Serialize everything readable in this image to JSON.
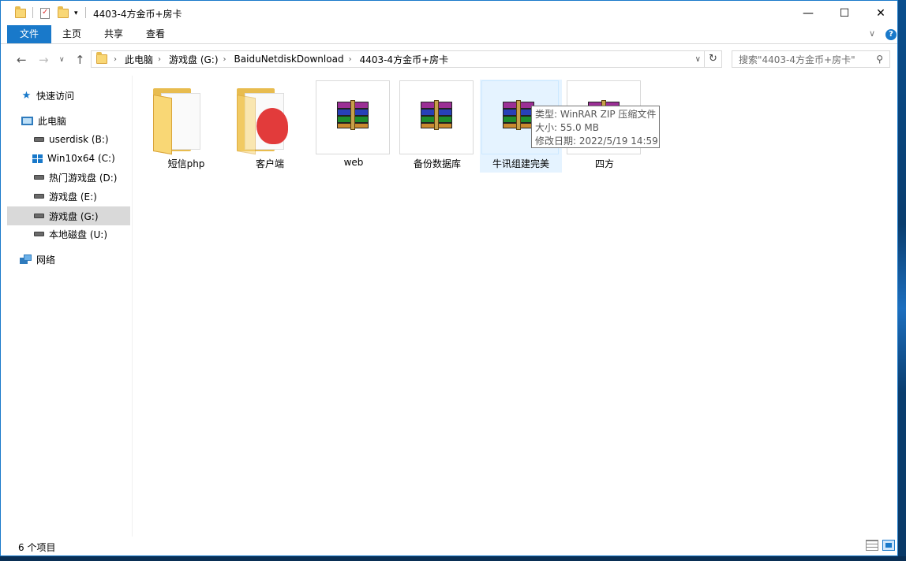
{
  "window": {
    "title": "4403-4方金币+房卡",
    "controls": {
      "minimize": "—",
      "maximize": "☐",
      "close": "✕"
    }
  },
  "ribbon": {
    "tabs": [
      "文件",
      "主页",
      "共享",
      "查看"
    ],
    "help": "?"
  },
  "address": {
    "crumbs": [
      "此电脑",
      "游戏盘 (G:)",
      "BaiduNetdiskDownload",
      "4403-4方金币+房卡"
    ]
  },
  "search": {
    "placeholder": "搜索\"4403-4方金币+房卡\""
  },
  "sidebar": {
    "items": [
      {
        "label": "快速访问",
        "icon": "star-icon"
      },
      {
        "label": "此电脑",
        "icon": "computer-icon"
      },
      {
        "label": "userdisk (B:)",
        "icon": "drive-icon"
      },
      {
        "label": "Win10x64 (C:)",
        "icon": "windows-drive-icon"
      },
      {
        "label": "热门游戏盘 (D:)",
        "icon": "drive-icon"
      },
      {
        "label": "游戏盘 (E:)",
        "icon": "drive-icon"
      },
      {
        "label": "游戏盘 (G:)",
        "icon": "drive-icon",
        "selected": true
      },
      {
        "label": "本地磁盘 (U:)",
        "icon": "drive-icon"
      },
      {
        "label": "网络",
        "icon": "network-icon"
      }
    ]
  },
  "files": [
    {
      "name": "短信php",
      "type": "folder"
    },
    {
      "name": "客户端",
      "type": "folder-app"
    },
    {
      "name": "web",
      "type": "winrar-archive"
    },
    {
      "name": "备份数据库",
      "type": "winrar-archive"
    },
    {
      "name": "牛讯组建完美",
      "type": "winrar-archive",
      "hovered": true
    },
    {
      "name": "四方",
      "type": "winrar-archive"
    }
  ],
  "tooltip": {
    "type": "类型: WinRAR ZIP 压缩文件",
    "size": "大小: 55.0 MB",
    "modified": "修改日期: 2022/5/19 14:59"
  },
  "status": {
    "count": "6 个项目"
  },
  "colors": {
    "accent": "#1979ca",
    "hover": "#e5f3ff",
    "selected": "#d9d9d9"
  }
}
